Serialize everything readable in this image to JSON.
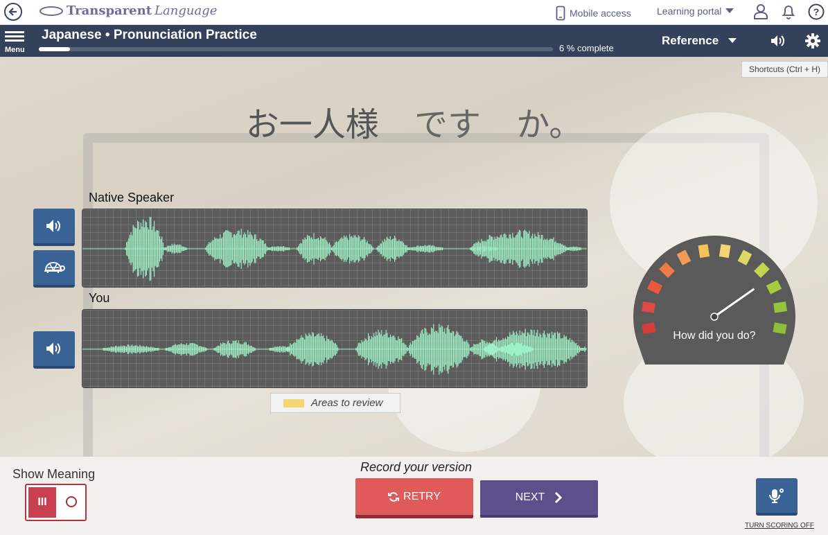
{
  "topbar": {
    "logo_bold": "Transparent",
    "logo_light": "Language",
    "mobile_access": "Mobile access",
    "learning_portal": "Learning portal"
  },
  "header": {
    "menu_label": "Menu",
    "title": "Japanese • Pronunciation Practice",
    "progress_fraction": 0.06,
    "progress_text": "6 % complete",
    "reference": "Reference"
  },
  "shortcuts": "Shortcuts (Ctrl + H)",
  "sentence": {
    "words": [
      "お一人様",
      "です",
      "か。"
    ]
  },
  "native": {
    "label": "Native Speaker"
  },
  "you": {
    "label": "You"
  },
  "legend": {
    "label": "Areas to review",
    "color": "#f4d774"
  },
  "gauge": {
    "label": "How did you do?",
    "colors": [
      "#d93a3a",
      "#e04747",
      "#e85a3e",
      "#ee7a45",
      "#f29a55",
      "#f5c25a",
      "#f4d774",
      "#ddd866",
      "#c2d452",
      "#a8cc3e",
      "#96c43b",
      "#8dc03a"
    ]
  },
  "bottom": {
    "show_meaning": "Show Meaning",
    "toggle_on": "III",
    "record_text": "Record your version",
    "retry": "RETRY",
    "next": "NEXT",
    "turn_scoring_off": "TURN SCORING OFF"
  },
  "colors": {
    "header": "#33415a",
    "speaker_button": "#3a6395",
    "retry": "#e05a5a",
    "next": "#5d4e8c",
    "waveform": "#9ff0c6"
  }
}
